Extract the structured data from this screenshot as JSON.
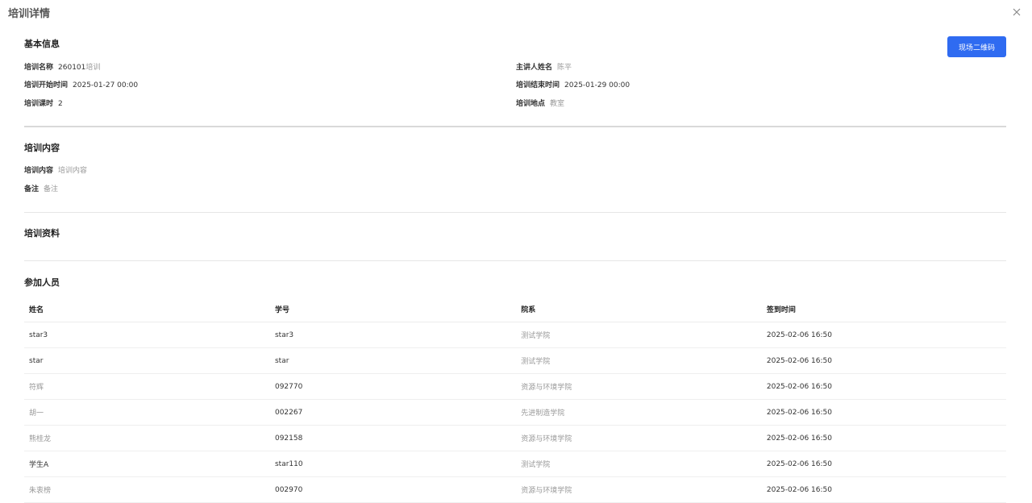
{
  "dialog": {
    "title": "培训详情"
  },
  "basic": {
    "section_title": "基本信息",
    "qr_button": "现场二维码",
    "name_label": "培训名称",
    "name_value_prefix": "260101",
    "name_value_suffix": "培训",
    "speaker_label": "主讲人姓名",
    "speaker_value": "陈平",
    "start_label": "培训开始时间",
    "start_value": "2025-01-27 00:00",
    "end_label": "培训结束时间",
    "end_value": "2025-01-29 00:00",
    "hours_label": "培训课时",
    "hours_value": "2",
    "location_label": "培训地点",
    "location_value": "教室"
  },
  "content": {
    "section_title": "培训内容",
    "content_label": "培训内容",
    "content_value": "培训内容",
    "remark_label": "备注",
    "remark_value": "备注"
  },
  "materials": {
    "section_title": "培训资料"
  },
  "participants": {
    "section_title": "参加人员",
    "columns": [
      "姓名",
      "学号",
      "院系",
      "签到时间"
    ],
    "rows": [
      {
        "name": "star3",
        "id": "star3",
        "dept": "测试学院",
        "time": "2025-02-06 16:50"
      },
      {
        "name": "star",
        "id": "star",
        "dept": "测试学院",
        "time": "2025-02-06 16:50"
      },
      {
        "name": "符辉",
        "id": "092770",
        "dept": "资源与环境学院",
        "time": "2025-02-06 16:50"
      },
      {
        "name": "胡一",
        "id": "002267",
        "dept": "先进制造学院",
        "time": "2025-02-06 16:50"
      },
      {
        "name": "熊桂龙",
        "id": "092158",
        "dept": "资源与环境学院",
        "time": "2025-02-06 16:50"
      },
      {
        "name": "学生A",
        "id": "star110",
        "dept": "测试学院",
        "time": "2025-02-06 16:50"
      },
      {
        "name": "朱衷榜",
        "id": "002970",
        "dept": "资源与环境学院",
        "time": "2025-02-06 16:50"
      }
    ]
  },
  "icons": {
    "close": "close-icon"
  }
}
